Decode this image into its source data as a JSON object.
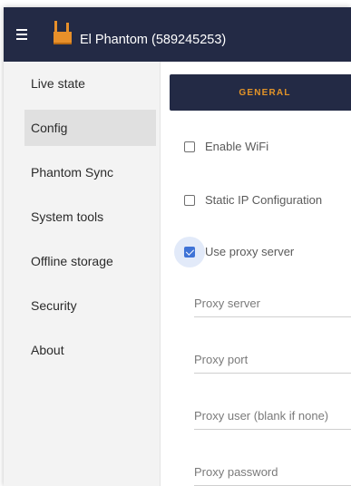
{
  "header": {
    "title": "El Phantom (589245253)",
    "menu_icon": "hamburger-menu-icon",
    "logo_icon": "phantom-logo-icon"
  },
  "sidebar": {
    "items": [
      {
        "label": "Live state",
        "active": false
      },
      {
        "label": "Config",
        "active": true
      },
      {
        "label": "Phantom Sync",
        "active": false
      },
      {
        "label": "System tools",
        "active": false
      },
      {
        "label": "Offline storage",
        "active": false
      },
      {
        "label": "Security",
        "active": false
      },
      {
        "label": "About",
        "active": false
      }
    ]
  },
  "tabs": {
    "general": "GENERAL"
  },
  "form": {
    "enable_wifi": {
      "label": "Enable WiFi",
      "checked": false
    },
    "static_ip": {
      "label": "Static IP Configuration",
      "checked": false
    },
    "use_proxy": {
      "label": "Use proxy server",
      "checked": true
    },
    "proxy_server": {
      "placeholder": "Proxy server",
      "value": ""
    },
    "proxy_port": {
      "placeholder": "Proxy port",
      "value": ""
    },
    "proxy_user": {
      "placeholder": "Proxy user (blank if none)",
      "value": ""
    },
    "proxy_password": {
      "placeholder": "Proxy password",
      "value": ""
    }
  },
  "colors": {
    "header_bg": "#232a45",
    "accent_orange": "#e39428",
    "checkbox_blue": "#3f73d6"
  }
}
